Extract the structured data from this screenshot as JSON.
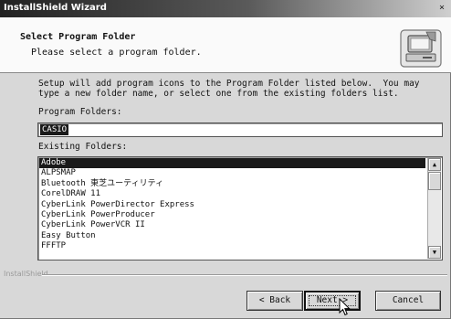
{
  "window": {
    "title": "InstallShield Wizard",
    "close_glyph": "×"
  },
  "header": {
    "title": "Select Program Folder",
    "subtitle": "Please select a program folder."
  },
  "description": "Setup will add program icons to the Program Folder listed below.  You may\ntype a new folder name, or select one from the existing folders list.",
  "program_folder": {
    "label": "Program Folders:",
    "value": "CASIO"
  },
  "existing_folders": {
    "label": "Existing Folders:",
    "items": [
      "Adobe",
      "ALPSMAP",
      "Bluetooth 東芝ユーティリティ",
      "CorelDRAW 11",
      "CyberLink PowerDirector Express",
      "CyberLink PowerProducer",
      "CyberLink PowerVCR II",
      "Easy Button",
      "FFFTP"
    ],
    "selected_index": 0
  },
  "footer": {
    "brand": "InstallShield",
    "back_label": "< Back",
    "next_label": "Next >",
    "cancel_label": "Cancel"
  },
  "icons": {
    "scroll_up": "▲",
    "scroll_down": "▼"
  }
}
